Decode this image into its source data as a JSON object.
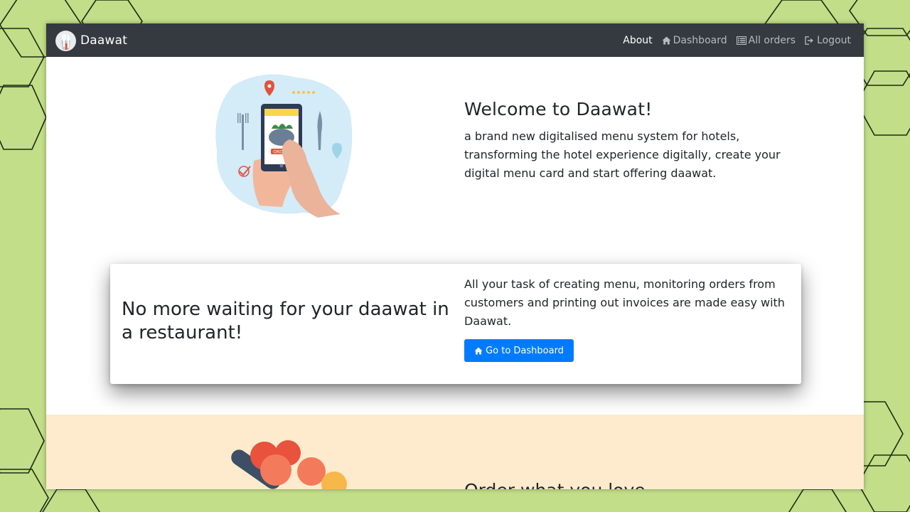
{
  "navbar": {
    "brand": "Daawat",
    "links": [
      {
        "label": "About",
        "icon": "none",
        "active": true
      },
      {
        "label": "Dashboard",
        "icon": "home-icon",
        "active": false
      },
      {
        "label": "All orders",
        "icon": "list-icon",
        "active": false
      },
      {
        "label": "Logout",
        "icon": "logout-icon",
        "active": false
      }
    ]
  },
  "hero": {
    "title": "Welcome to Daawat!",
    "description": "a brand new digitalised menu system for hotels, transforming the hotel experience digitally, create your digital menu card and start offering daawat.",
    "illustration_label": "ORDER"
  },
  "card": {
    "heading": "No more waiting for your daawat in a restaurant!",
    "text": "All your task of creating menu, monitoring orders from customers and printing out invoices are made easy with Daawat.",
    "button_label": "Go to Dashboard"
  },
  "next_section": {
    "title": "Order what you love"
  },
  "colors": {
    "navbar": "#343a40",
    "primary": "#007bff",
    "page_background": "#c2de88",
    "peach_section": "#feebcd"
  }
}
